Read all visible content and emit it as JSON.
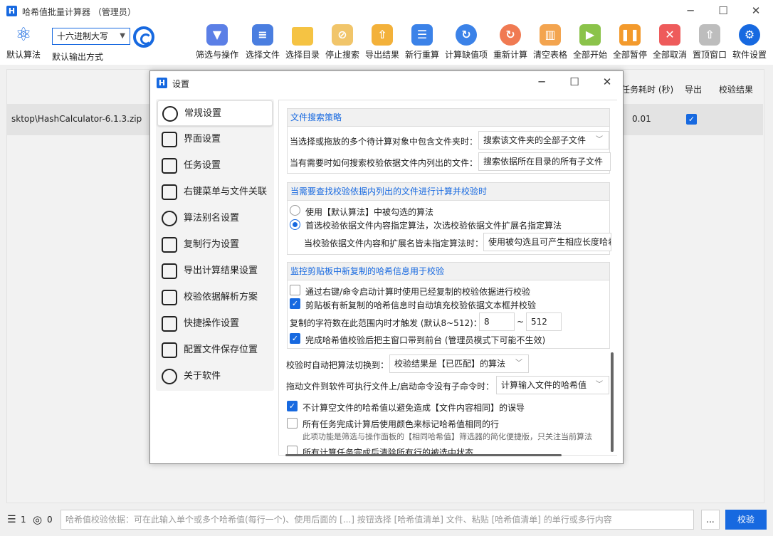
{
  "window": {
    "title": "哈希值批量计算器 （管理员）",
    "logo_letter": "H",
    "minimize": "─",
    "maximize": "☐",
    "close": "✕"
  },
  "toolbar": {
    "default_algo_label": "默认算法",
    "output_format_label": "默认输出方式",
    "output_format_value": "十六进制大写",
    "buttons": [
      {
        "label": "筛选与操作",
        "icon": "filter-icon",
        "color": "#5b7fe6",
        "glyph": "▼"
      },
      {
        "label": "选择文件",
        "icon": "file-list-icon",
        "color": "#4a7ee0",
        "glyph": "≡"
      },
      {
        "label": "选择目录",
        "icon": "folder-icon",
        "color": "#f5c343",
        "glyph": ""
      },
      {
        "label": "停止搜索",
        "icon": "stop-search-icon",
        "color": "#f1c56a",
        "glyph": "⊘"
      },
      {
        "label": "导出结果",
        "icon": "export-icon",
        "color": "#f3b13a",
        "glyph": "⇧"
      },
      {
        "label": "新行重算",
        "icon": "new-row-icon",
        "color": "#3b82e8",
        "glyph": "☰"
      },
      {
        "label": "计算缺值项",
        "icon": "compute-missing-icon",
        "color": "#3b82e8",
        "glyph": "↻"
      },
      {
        "label": "重新计算",
        "icon": "recompute-icon",
        "color": "#f07a52",
        "glyph": "↻"
      },
      {
        "label": "清空表格",
        "icon": "clear-table-icon",
        "color": "#f3a44f",
        "glyph": "▥"
      },
      {
        "label": "全部开始",
        "icon": "start-all-icon",
        "color": "#8bc34a",
        "glyph": "▶"
      },
      {
        "label": "全部暂停",
        "icon": "pause-all-icon",
        "color": "#f39a2c",
        "glyph": "❚❚"
      },
      {
        "label": "全部取消",
        "icon": "cancel-all-icon",
        "color": "#ee5b5b",
        "glyph": "✕"
      },
      {
        "label": "置顶窗口",
        "icon": "pin-top-icon",
        "color": "#bdbdbd",
        "glyph": "⇧"
      },
      {
        "label": "软件设置",
        "icon": "settings-gear-icon",
        "color": "#1769e0",
        "glyph": "⚙"
      }
    ]
  },
  "table": {
    "headers": {
      "duration": "任务耗时 (秒)",
      "export": "导出",
      "verify": "校验结果"
    },
    "rows": [
      {
        "file": "sktop\\HashCalculator-6.1.3.zip",
        "duration": "0.01",
        "export_checked": true
      }
    ]
  },
  "bottom": {
    "row_count": "1",
    "selected_count": "0",
    "placeholder": "哈希值校验依据：可在此输入单个或多个哈希值(每行一个)、使用后面的 [...] 按钮选择 [哈希值清单] 文件、粘贴 [哈希值清单] 的单行或多行内容",
    "browse_label": "...",
    "verify_button": "校验"
  },
  "dialog": {
    "title": "设置",
    "nav": [
      {
        "label": "常规设置",
        "icon": "gear-settings-icon",
        "active": true
      },
      {
        "label": "界面设置",
        "icon": "interface-settings-icon",
        "active": false
      },
      {
        "label": "任务设置",
        "icon": "task-list-icon",
        "active": false
      },
      {
        "label": "右键菜单与文件关联",
        "icon": "mouse-icon",
        "active": false
      },
      {
        "label": "算法别名设置",
        "icon": "atom-icon",
        "active": false
      },
      {
        "label": "复制行为设置",
        "icon": "copy-doc-icon",
        "active": false
      },
      {
        "label": "导出计算结果设置",
        "icon": "export-arrow-icon",
        "active": false
      },
      {
        "label": "校验依据解析方案",
        "icon": "checklist-icon",
        "active": false
      },
      {
        "label": "快捷操作设置",
        "icon": "paper-plane-icon",
        "active": false
      },
      {
        "label": "配置文件保存位置",
        "icon": "config-file-icon",
        "active": false
      },
      {
        "label": "关于软件",
        "icon": "info-icon",
        "active": false
      }
    ],
    "sections": {
      "search": {
        "title": "文件搜索策略",
        "row1_label": "当选择或拖放的多个待计算对象中包含文件夹时：",
        "row1_value": "搜索该文件夹的全部子文件",
        "row2_label": "当有需要时如何搜索校验依据文件内列出的文件：",
        "row2_value": "搜索依据所在目录的所有子文件"
      },
      "verify": {
        "title": "当需要查找校验依据内列出的文件进行计算并校验时",
        "option1": "使用【默认算法】中被勾选的算法",
        "option2": "首选校验依据文件内容指定算法，次选校验依据文件扩展名指定算法",
        "row_label": "当校验依据文件内容和扩展名皆未指定算法时：",
        "row_value": "使用被勾选且可产生相应长度哈希"
      },
      "clipboard": {
        "title": "监控剪贴板中新复制的哈希信息用于校验",
        "check1": "通过右键/命令启动计算时使用已经复制的校验依据进行校验",
        "check2": "剪贴板有新复制的哈希信息时自动填充校验依据文本框并校验",
        "range_label": "复制的字符数在此范围内时才触发 (默认8~512)：",
        "range_min": "8",
        "range_sep": "~",
        "range_max": "512",
        "check3": "完成哈希值校验后把主窗口带到前台 (管理员模式下可能不生效)"
      },
      "misc": {
        "switch_label": "校验时自动把算法切换到：",
        "switch_value": "校验结果是【已匹配】的算法",
        "drag_label": "拖动文件到软件可执行文件上/启动命令没有子命令时：",
        "drag_value": "计算输入文件的哈希值",
        "check_empty": "不计算空文件的哈希值以避免造成【文件内容相同】的误导",
        "check_color": "所有任务完成计算后使用颜色来标记哈希值相同的行",
        "color_note": "此项功能是筛选与操作面板的【相同哈希值】筛选器的简化便捷版，只关注当前算法",
        "check_cut": "所有计算任务完成后清除所有行的被选中状态"
      }
    }
  }
}
